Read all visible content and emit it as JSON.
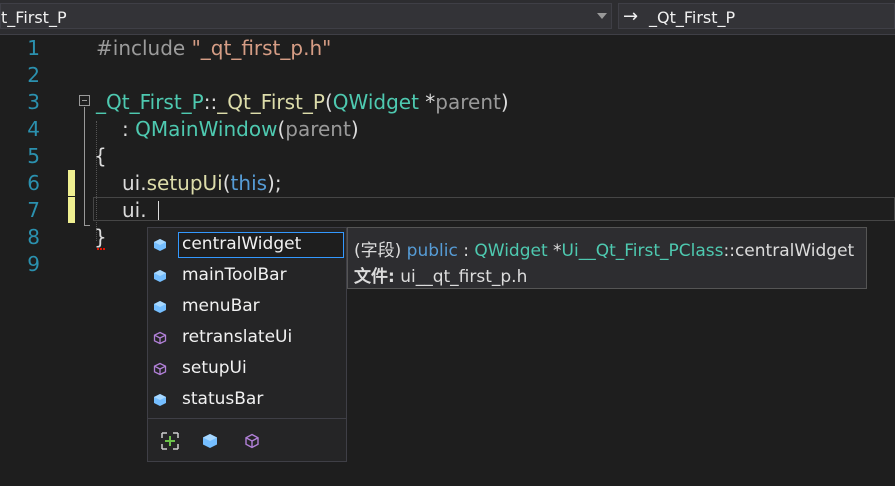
{
  "navbar": {
    "scope_left": "t_First_P",
    "scope_right": "_Qt_First_P",
    "arrow_glyph": "→"
  },
  "editor": {
    "line_numbers": [
      "1",
      "2",
      "3",
      "4",
      "5",
      "6",
      "7",
      "8",
      "9"
    ],
    "line1": {
      "directive": "#include",
      "path": " \"_qt_first_p.h\""
    },
    "line3": {
      "class_a": "_Qt_First_P",
      "sep": "::",
      "ctor": "_Qt_First_P",
      "open": "(",
      "type": "QWidget",
      "ptr": " *",
      "param": "parent",
      "close": ")"
    },
    "line4": {
      "colon": ": ",
      "base": "QMainWindow",
      "open": "(",
      "param": "parent",
      "close": ")"
    },
    "line5": {
      "brace": "{"
    },
    "line6": {
      "obj": "ui.",
      "method": "setupUi",
      "open": "(",
      "kw": "this",
      "close": ");"
    },
    "line7": {
      "obj": "ui."
    },
    "line8": {
      "brace": "}"
    }
  },
  "completion": {
    "items": [
      {
        "label": "centralWidget",
        "icon": "field-icon",
        "selected": true
      },
      {
        "label": "mainToolBar",
        "icon": "field-icon"
      },
      {
        "label": "menuBar",
        "icon": "field-icon"
      },
      {
        "label": "retranslateUi",
        "icon": "method-icon"
      },
      {
        "label": "setupUi",
        "icon": "method-icon"
      },
      {
        "label": "statusBar",
        "icon": "field-icon"
      }
    ],
    "footer_filters": [
      "expand-filter-icon",
      "field-filter-icon",
      "method-filter-icon"
    ]
  },
  "tooltip": {
    "kind": "(字段)",
    "access": "public",
    "colon": " : ",
    "type": "QWidget",
    "ptr": " *",
    "owner": "Ui__Qt_First_PClass",
    "member": "::centralWidget",
    "file_label": "文件:",
    "file_name": " ui__qt_first_p.h"
  },
  "colors": {
    "background": "#1e1e1e",
    "line_number": "#2b91af",
    "type": "#4ec9b0",
    "function": "#dcdcaa",
    "keyword": "#569cd6",
    "string": "#d69d85",
    "change_bar": "#efef91",
    "field_icon": "#75beff",
    "method_icon": "#b180d7"
  }
}
